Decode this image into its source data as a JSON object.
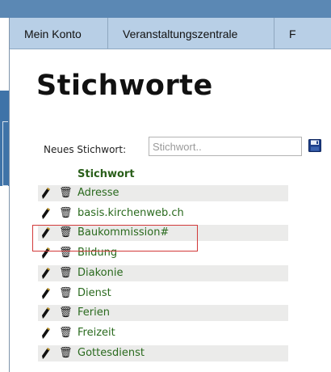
{
  "nav": {
    "items": [
      {
        "label": "Mein Konto"
      },
      {
        "label": "Veranstaltungszentrale"
      },
      {
        "label": "F"
      }
    ]
  },
  "page": {
    "title": "Stichworte"
  },
  "new_keyword": {
    "label": "Neues Stichwort:",
    "placeholder": "Stichwort.."
  },
  "table": {
    "header": "Stichwort",
    "rows": [
      {
        "label": "Adresse"
      },
      {
        "label": "basis.kirchenweb.ch"
      },
      {
        "label": "Baukommission#"
      },
      {
        "label": "Bildung"
      },
      {
        "label": "Diakonie"
      },
      {
        "label": "Dienst"
      },
      {
        "label": "Ferien"
      },
      {
        "label": "Freizeit"
      },
      {
        "label": "Gottesdienst"
      }
    ]
  },
  "colors": {
    "link": "#2a6a1e",
    "nav_bg": "#b8cfe6",
    "highlight": "#d23a3a",
    "row_shade": "#ebebea"
  },
  "icons": {
    "edit": "pencil-icon",
    "delete": "trash-icon",
    "save": "floppy-disk-icon"
  }
}
